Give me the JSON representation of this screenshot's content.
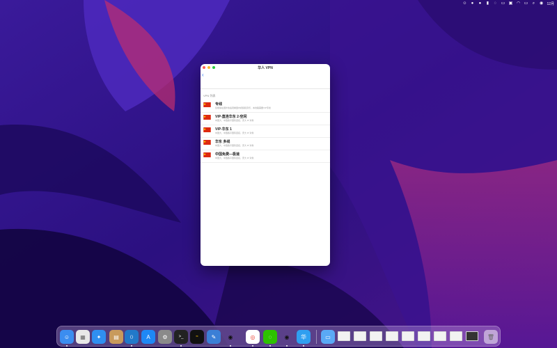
{
  "colors": {
    "accent": "#2f7bf5",
    "wallpaper_dark": "#1c0b55",
    "wallpaper_mid": "#4b1fa8",
    "wallpaper_pink": "#c0307a"
  },
  "menubar": {
    "icons": [
      "smiley-icon",
      "microphone-icon",
      "microphone-icon",
      "battery-icon",
      "wechat-icon",
      "card-icon",
      "input-method-icon",
      "wifi-icon",
      "display-icon",
      "search-icon",
      "control-center-icon"
    ],
    "clock": "12月"
  },
  "window": {
    "title": "华人 VPN",
    "back_icon": "chevron-left-icon",
    "section_title": "VPN 列表",
    "items": [
      {
        "name": "专线",
        "desc": "您能够在国外快速观看国内视频和音乐，本线路需要VIP专线"
      },
      {
        "name": "VIP-直连华东 2-空闲",
        "desc": "中国大，中国各平国际连接，安大 IP 对象"
      },
      {
        "name": "VIP-华东 1",
        "desc": "中国大，中国各平国际连接，安大 IP 对象"
      },
      {
        "name": "华东 多线",
        "desc": "中国大，中国各平国际连接，安大 IP 对象"
      },
      {
        "name": "中国免费—极速",
        "desc": "中国大，中国各平国际连接，安大 IP 对象"
      }
    ]
  },
  "dock": {
    "apps": [
      {
        "name": "finder-icon",
        "glyph": "☺",
        "color": "#3b8df0"
      },
      {
        "name": "launchpad-icon",
        "glyph": "▦",
        "color": "#e8e8e8"
      },
      {
        "name": "safari-icon",
        "glyph": "✦",
        "color": "#2f8ff0"
      },
      {
        "name": "archive-icon",
        "glyph": "▤",
        "color": "#c89a5c"
      },
      {
        "name": "vscode-icon",
        "glyph": "⟨⟩",
        "color": "#2279c9"
      },
      {
        "name": "app-store-icon",
        "glyph": "A",
        "color": "#1e88f5"
      },
      {
        "name": "system-preferences-icon",
        "glyph": "⚙",
        "color": "#8a8a8a"
      },
      {
        "name": "terminal-icon",
        "glyph": ">_",
        "color": "#222222"
      },
      {
        "name": "activity-monitor-icon",
        "glyph": "≈",
        "color": "#111111"
      },
      {
        "name": "xcode-icon",
        "glyph": "✎",
        "color": "#3b7fd6"
      },
      {
        "name": "qq-icon",
        "glyph": "◉",
        "color": "#f5c800"
      },
      {
        "name": "chrome-icon",
        "glyph": "◎",
        "color": "#e94235"
      },
      {
        "name": "wechat-icon",
        "glyph": "◌",
        "color": "#2dc100"
      },
      {
        "name": "qq-icon",
        "glyph": "◉",
        "color": "#f5c800"
      },
      {
        "name": "huaren-vpn-icon",
        "glyph": "华",
        "color": "#2f9ff0"
      }
    ],
    "folder_icon": "downloads-folder-icon",
    "trash_icon": "trash-icon"
  }
}
